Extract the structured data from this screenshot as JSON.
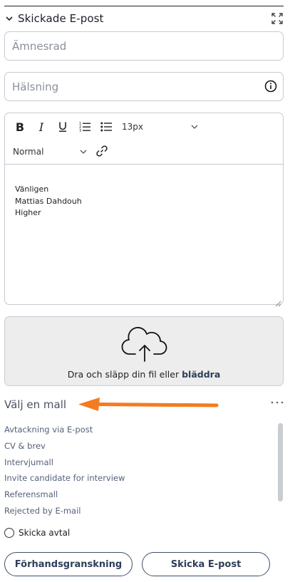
{
  "header": {
    "title": "Skickade E-post",
    "toggle_icon": "chevron-down-icon",
    "expand_icon": "expand-icon"
  },
  "subject": {
    "placeholder": "Ämnesrad",
    "value": ""
  },
  "greeting": {
    "placeholder": "Hälsning",
    "value": "",
    "info_icon": "info-icon"
  },
  "editor": {
    "toolbar": {
      "bold_label": "B",
      "italic_label": "I",
      "font_size": "13px",
      "block_format": "Normal"
    },
    "body_lines": [
      "Vänligen",
      "Mattias Dahdouh",
      "Higher"
    ]
  },
  "dropzone": {
    "text": "Dra och släpp din fil eller",
    "browse_label": "bläddra",
    "icon": "cloud-upload-icon"
  },
  "templates": {
    "title": "Välj en mall",
    "arrow_color": "#f47b20",
    "items": [
      "Avtackning via E-post",
      "CV & brev",
      "Intervjumall",
      "Invite candidate for interview",
      "Referensmall",
      "Rejected by E-mail"
    ]
  },
  "contract": {
    "label": "Skicka avtal",
    "checked": false
  },
  "actions": {
    "preview_label": "Förhandsgranskning",
    "send_label": "Skicka E-post"
  },
  "colors": {
    "accent": "#2e3e58",
    "border": "#c7cad1",
    "dropzone_bg": "#ededee",
    "annotation_arrow": "#f47b20"
  }
}
